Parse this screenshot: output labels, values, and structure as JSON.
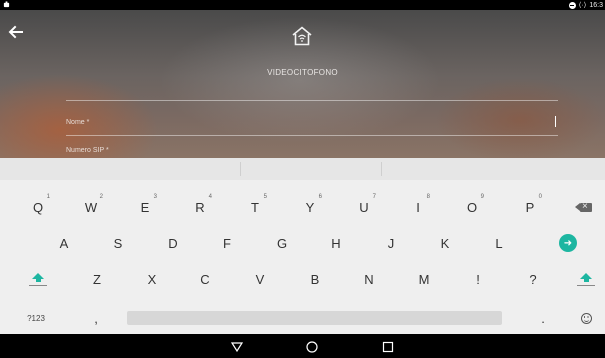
{
  "status_bar": {
    "left_icon": "notification-icon",
    "sync_glyph": "⟨·⟩",
    "time": "16:3"
  },
  "header": {
    "back_icon": "arrow-left-icon",
    "home_icon": "home-icon",
    "title": "VIDEOCITOFONO"
  },
  "form": {
    "fields": [
      {
        "label": "Nome *",
        "value": ""
      },
      {
        "label": "Numero SIP *",
        "value": ""
      }
    ]
  },
  "keyboard": {
    "row1": [
      {
        "key": "Q",
        "hint": "1"
      },
      {
        "key": "W",
        "hint": "2"
      },
      {
        "key": "E",
        "hint": "3"
      },
      {
        "key": "R",
        "hint": "4"
      },
      {
        "key": "T",
        "hint": "5"
      },
      {
        "key": "Y",
        "hint": "6"
      },
      {
        "key": "U",
        "hint": "7"
      },
      {
        "key": "I",
        "hint": "8"
      },
      {
        "key": "O",
        "hint": "9"
      },
      {
        "key": "P",
        "hint": "0"
      }
    ],
    "row2": [
      "A",
      "S",
      "D",
      "F",
      "G",
      "H",
      "J",
      "K",
      "L"
    ],
    "row3": [
      "Z",
      "X",
      "C",
      "V",
      "B",
      "N",
      "M",
      "!",
      "?"
    ],
    "row4": {
      "symbols": "?123",
      "comma": ",",
      "period": "."
    },
    "accent_color": "#1db6a1"
  },
  "navbar": {
    "back": "▽",
    "home": "○",
    "recents": "□"
  }
}
